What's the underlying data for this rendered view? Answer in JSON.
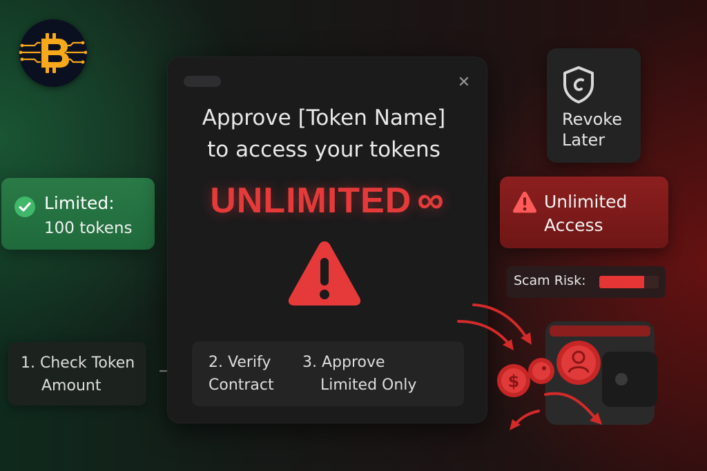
{
  "colors": {
    "accent_red": "#e63a3a",
    "safe_green": "#2a7a47",
    "dialog_bg": "#1b1b1c",
    "bitcoin_orange": "#f7a81b"
  },
  "logo": {
    "icon": "bitcoin-icon"
  },
  "dialog": {
    "close_icon": "close-icon",
    "close_glyph": "✕",
    "title_line1": "Approve [Token Name]",
    "title_line2": "to access your tokens",
    "unlimited_label": "UNLIMITED",
    "infinity_glyph": "∞",
    "warning_icon": "warning-triangle-icon",
    "steps": [
      {
        "line1": "2. Verify",
        "line2": "Contract"
      },
      {
        "line1": "3. Approve",
        "line2": "Limited Only"
      }
    ]
  },
  "limited_card": {
    "icon": "check-circle-icon",
    "line1": "Limited:",
    "line2": "100 tokens"
  },
  "step1_card": {
    "line1": "1. Check Token",
    "line2": "Amount",
    "arrow_icon": "arrow-right-icon"
  },
  "revoke_card": {
    "icon": "shield-icon",
    "line1": "Revoke",
    "line2": "Later"
  },
  "access_card": {
    "icon": "warning-triangle-icon",
    "line1": "Unlimited",
    "line2": "Access"
  },
  "scam_risk": {
    "label": "Scam Risk:",
    "level": 0.76
  },
  "wallet_illustration": {
    "icons": [
      "wallet-icon",
      "coin-icon",
      "dollar-coin-icon",
      "user-coin-icon",
      "red-arrow-icon"
    ]
  }
}
